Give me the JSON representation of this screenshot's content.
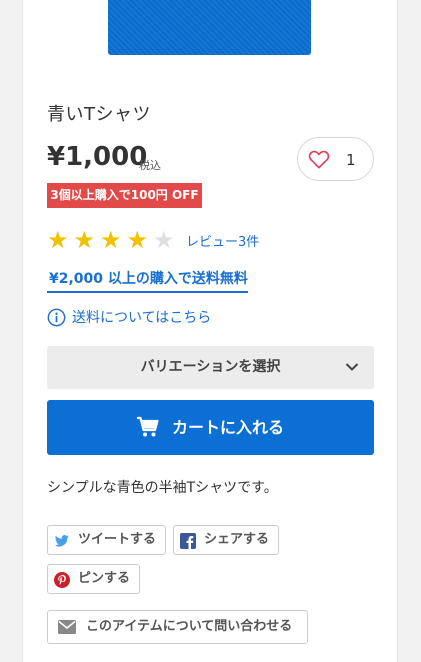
{
  "product": {
    "title": "青いTシャツ",
    "price": "¥1,000",
    "tax_label": "税込",
    "discount_badge": "3個以上購入で100円 OFF",
    "rating": 4,
    "rating_max": 5,
    "review_link": "レビュー3件",
    "description": "シンプルな青色の半袖Tシャツです。",
    "image_color": "#0a6fd2"
  },
  "favorite": {
    "count": "1",
    "icon": "heart-icon"
  },
  "shipping": {
    "free_label": "¥2,000 以上の購入で送料無料",
    "info_label": "送料についてはこちら"
  },
  "variation": {
    "label": "バリエーションを選択"
  },
  "cart": {
    "label": "カートに入れる",
    "color": "#0b6fd3"
  },
  "share": {
    "tweet": "ツイートする",
    "facebook": "シェアする",
    "pin": "ピンする",
    "contact": "このアイテムについて問い合わせる"
  },
  "colors": {
    "accent": "#1a6fd1",
    "badge": "#e24a4a",
    "star": "#f2c200"
  }
}
